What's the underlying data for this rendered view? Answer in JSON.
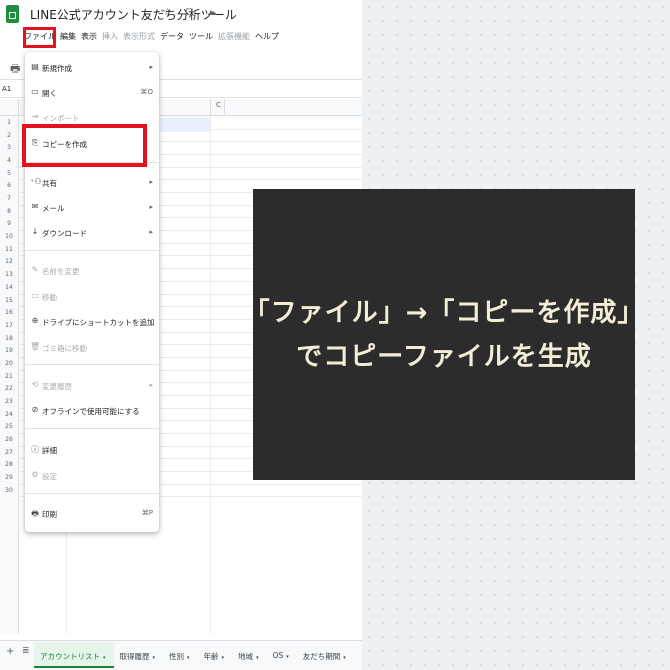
{
  "header": {
    "title": "LINE公式アカウント友だち分析ツール",
    "title_icons": "☆ ⊡ ☁"
  },
  "menubar": {
    "items": [
      {
        "label": "ファイル",
        "disabled": false
      },
      {
        "label": "編集",
        "disabled": false
      },
      {
        "label": "表示",
        "disabled": false
      },
      {
        "label": "挿入",
        "disabled": true
      },
      {
        "label": "表示形式",
        "disabled": true
      },
      {
        "label": "データ",
        "disabled": false
      },
      {
        "label": "ツール",
        "disabled": false
      },
      {
        "label": "拡張機能",
        "disabled": true
      },
      {
        "label": "ヘルプ",
        "disabled": false
      }
    ]
  },
  "toolbar": {
    "print_icon": "🖶"
  },
  "sheet": {
    "namebox": "A1",
    "column_c": "C",
    "row_numbers": [
      "1",
      "2",
      "3",
      "4",
      "5",
      "6",
      "7",
      "8",
      "9",
      "10",
      "11",
      "12",
      "13",
      "14",
      "15",
      "16",
      "17",
      "18",
      "19",
      "20",
      "21",
      "22",
      "23",
      "24",
      "25",
      "26",
      "27",
      "28",
      "29",
      "30"
    ]
  },
  "file_menu": {
    "items": [
      {
        "icon": "▤",
        "icon_name": "new-sheet-icon",
        "label": "新規作成",
        "right": "▸",
        "disabled": false
      },
      {
        "icon": "▭",
        "icon_name": "folder-open-icon",
        "label": "開く",
        "right": "⌘O",
        "disabled": false
      },
      {
        "icon": "⇥",
        "icon_name": "import-icon",
        "label": "インポート",
        "right": "",
        "disabled": true
      },
      {
        "icon": "⎘",
        "icon_name": "copy-icon",
        "label": "コピーを作成",
        "right": "",
        "disabled": false
      },
      {
        "icon": "⁺⚇",
        "icon_name": "share-icon",
        "label": "共有",
        "right": "▸",
        "disabled": false
      },
      {
        "icon": "✉",
        "icon_name": "mail-icon",
        "label": "メール",
        "right": "▸",
        "disabled": false
      },
      {
        "icon": "↓",
        "icon_name": "download-icon",
        "label": "ダウンロード",
        "right": "▸",
        "disabled": false
      },
      {
        "icon": "✎",
        "icon_name": "rename-icon",
        "label": "名前を変更",
        "right": "",
        "disabled": true
      },
      {
        "icon": "▭",
        "icon_name": "move-icon",
        "label": "移動",
        "right": "",
        "disabled": true
      },
      {
        "icon": "⊕",
        "icon_name": "drive-shortcut-icon",
        "label": "ドライブにショートカットを追加",
        "right": "",
        "disabled": false
      },
      {
        "icon": "🗑",
        "icon_name": "trash-icon",
        "label": "ゴミ箱に移動",
        "right": "",
        "disabled": true
      },
      {
        "icon": "⟲",
        "icon_name": "history-icon",
        "label": "変更履歴",
        "right": "▸",
        "disabled": true
      },
      {
        "icon": "⊘",
        "icon_name": "offline-icon",
        "label": "オフラインで使用可能にする",
        "right": "",
        "disabled": false
      },
      {
        "icon": "ⓘ",
        "icon_name": "details-icon",
        "label": "詳細",
        "right": "",
        "disabled": false
      },
      {
        "icon": "⚙",
        "icon_name": "settings-icon",
        "label": "設定",
        "right": "",
        "disabled": true
      },
      {
        "icon": "🖶",
        "icon_name": "print-icon",
        "label": "印刷",
        "right": "⌘P",
        "disabled": false
      }
    ]
  },
  "tabs": {
    "add": "+",
    "list": "≣",
    "items": [
      {
        "label": "アカウントリスト",
        "active": true
      },
      {
        "label": "取得履歴",
        "active": false
      },
      {
        "label": "性別",
        "active": false
      },
      {
        "label": "年齢",
        "active": false
      },
      {
        "label": "地域",
        "active": false
      },
      {
        "label": "OS",
        "active": false
      },
      {
        "label": "友だち期間",
        "active": false
      }
    ],
    "caret": "▾"
  },
  "caption": {
    "line1": "「ファイル」→「コピーを作成」",
    "line2": "でコピーファイルを生成"
  },
  "colors": {
    "highlight": "#e3121b",
    "caption_bg": "#2c2c2c",
    "caption_text": "#f3ecd7",
    "accent": "#188038"
  }
}
